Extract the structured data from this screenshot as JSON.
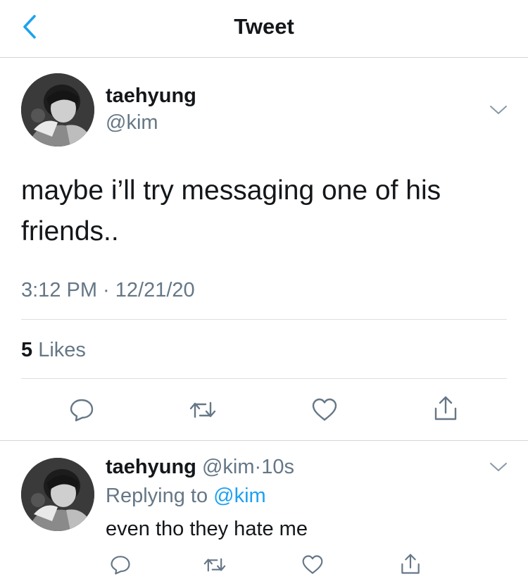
{
  "header": {
    "title": "Tweet",
    "back_icon": "chevron-left-icon",
    "accent_color": "#1da1f2"
  },
  "tweet": {
    "display_name": "taehyung",
    "handle": "@kim",
    "text": "maybe i’ll try messaging one of his friends..",
    "timestamp": "3:12 PM · 12/21/20",
    "likes_count": "5",
    "likes_label": "Likes",
    "more_icon": "chevron-down-icon"
  },
  "actions": {
    "reply_icon": "comment-icon",
    "retweet_icon": "retweet-icon",
    "like_icon": "heart-icon",
    "share_icon": "share-icon"
  },
  "reply": {
    "display_name": "taehyung",
    "handle": "@kim",
    "separator": "·",
    "time": "10s",
    "replying_prefix": "Replying to",
    "replying_to": "@kim",
    "text": "even tho they hate me"
  },
  "colors": {
    "text_primary": "#14171a",
    "text_secondary": "#657786",
    "link": "#1da1f2",
    "icon_gray": "#657786"
  }
}
